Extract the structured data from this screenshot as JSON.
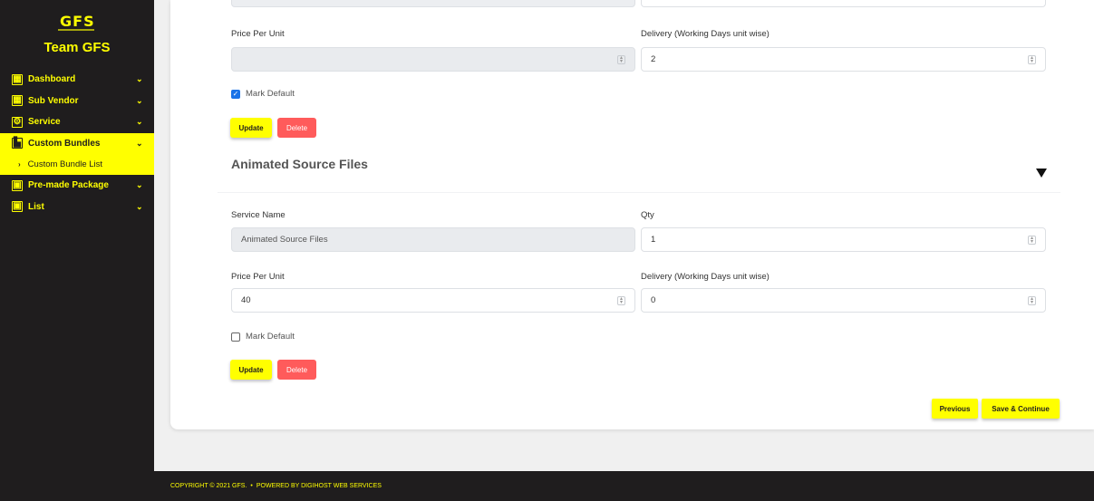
{
  "sidebar": {
    "logo": "GFS",
    "team": "Team GFS",
    "items": [
      {
        "label": "Dashboard",
        "icon": "dashboard-icon"
      },
      {
        "label": "Sub Vendor",
        "icon": "sub-vendor-icon"
      },
      {
        "label": "Service",
        "icon": "service-icon"
      },
      {
        "label": "Custom Bundles",
        "icon": "custom-bundles-icon",
        "active": true
      },
      {
        "label": "Pre-made Package",
        "icon": "package-icon"
      },
      {
        "label": "List",
        "icon": "list-icon"
      }
    ],
    "sub_item": "Custom Bundle List"
  },
  "bundle1": {
    "price_label": "Price Per Unit",
    "price_value": "",
    "delivery_label": "Delivery (Working Days unit wise)",
    "delivery_value": "2",
    "mark_default": "Mark Default",
    "mark_default_checked": true,
    "update": "Update",
    "delete": "Delete"
  },
  "bundle2": {
    "title": "Animated Source Files",
    "service_label": "Service Name",
    "service_value": "Animated Source Files",
    "qty_label": "Qty",
    "qty_value": "1",
    "price_label": "Price Per Unit",
    "price_value": "40",
    "delivery_label": "Delivery (Working Days unit wise)",
    "delivery_value": "0",
    "mark_default": "Mark Default",
    "mark_default_checked": false,
    "update": "Update",
    "delete": "Delete"
  },
  "actions": {
    "previous": "Previous",
    "save_continue": "Save & Continue"
  },
  "footer": {
    "copyright": "COPYRIGHT © 2021 GFS.",
    "bullet": "•",
    "powered": "POWERED BY DIGIHOST WEB SERVICES"
  },
  "colors": {
    "accent": "#ffff00",
    "sidebar_bg": "#1f1d1e",
    "delete": "#ff5b5b"
  }
}
